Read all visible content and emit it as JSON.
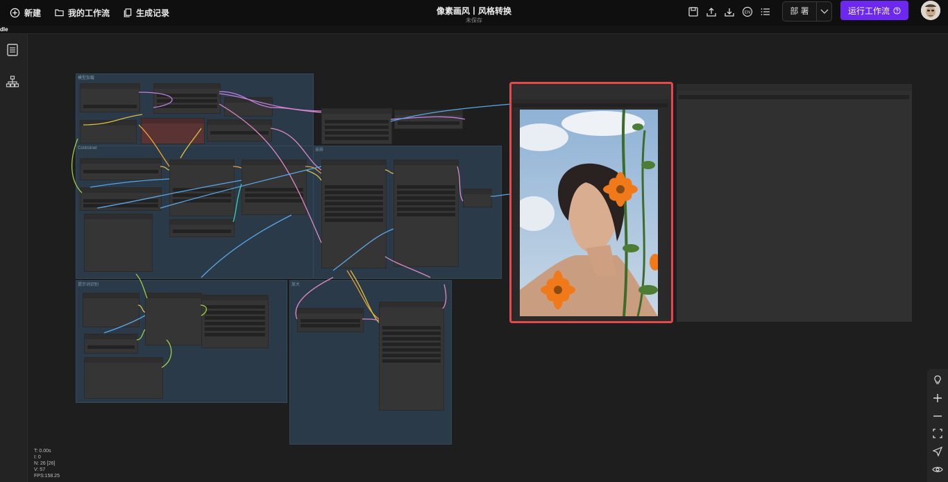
{
  "topbar": {
    "new_label": "新建",
    "my_workflows_label": "我的工作流",
    "history_label": "生成记录",
    "title": "像素画风丨风格转换",
    "subtitle": "未保存",
    "deploy_label": "部 署",
    "run_label": "运行工作流"
  },
  "strip_text": "dle",
  "groups": {
    "g1": "模型加载",
    "g2": "Controlnet",
    "g3": "采样",
    "g4": "提示词识别",
    "g5": "放大"
  },
  "stats": {
    "t": "T: 0.00s",
    "i": "I: 0",
    "n": "N: 26 [26]",
    "v": "V: 57",
    "fps": "FPS:158.25"
  },
  "colors": {
    "accent": "#6d28f0",
    "highlight": "#e5484d",
    "group_bg": "#2b3a48"
  },
  "icons": [
    "plus-circle-icon",
    "folder-icon",
    "history-icon",
    "save-icon",
    "upload-icon",
    "download-icon",
    "language-icon",
    "list-icon",
    "chevron-down-icon",
    "question-icon",
    "document-icon",
    "hierarchy-icon",
    "bulb-icon",
    "zoom-in-icon",
    "zoom-out-icon",
    "fit-view-icon",
    "send-icon",
    "eye-icon"
  ]
}
